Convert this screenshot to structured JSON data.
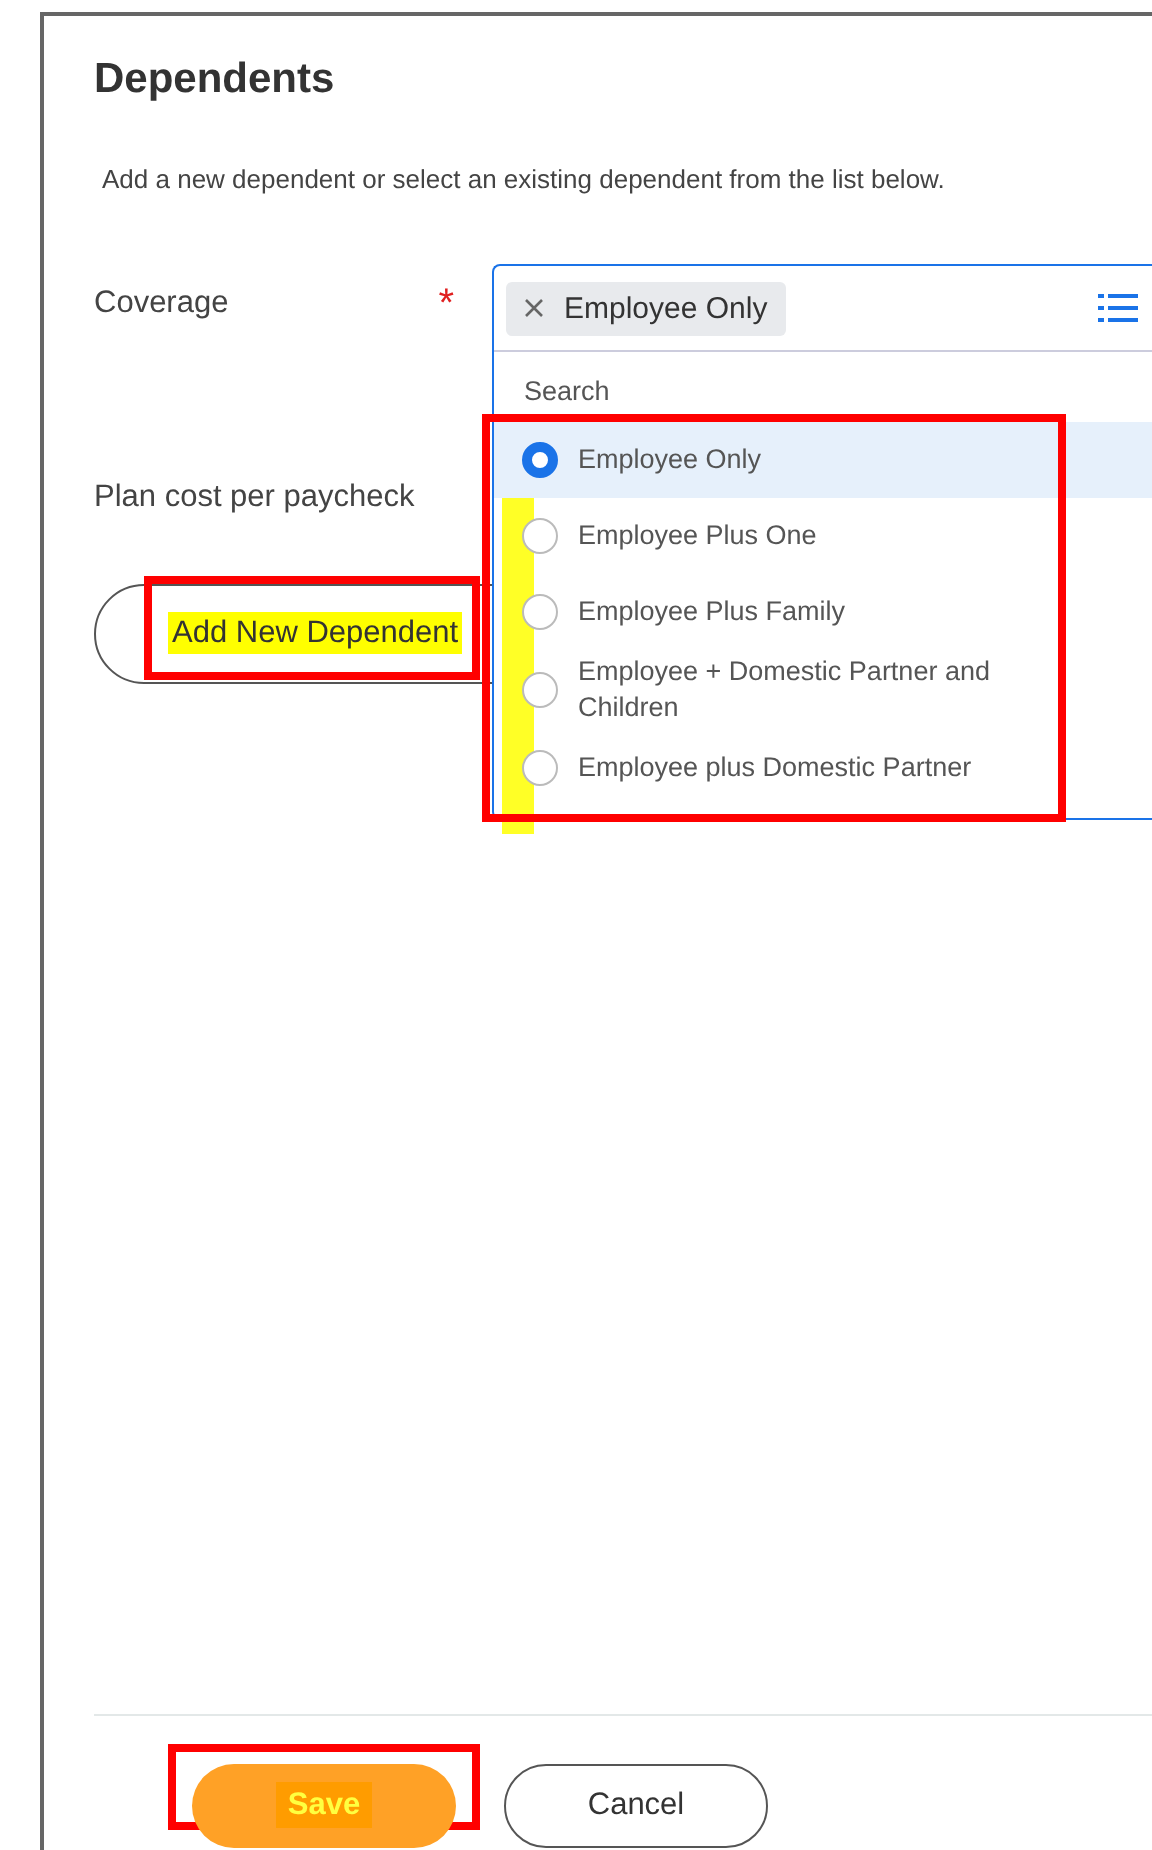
{
  "title": "Dependents",
  "description": "Add a new dependent or select an existing dependent from the list below.",
  "coverage": {
    "label": "Coverage",
    "required": true,
    "required_mark": "*",
    "chip": "Employee Only",
    "dropdown": {
      "search_placeholder": "Search",
      "boxed": true,
      "highlighted": true,
      "options": [
        {
          "label": "Employee Only",
          "selected": true
        },
        {
          "label": "Employee Plus One",
          "selected": false
        },
        {
          "label": "Employee Plus Family",
          "selected": false
        },
        {
          "label": "Employee + Domestic Partner and Children",
          "selected": false
        },
        {
          "label": "Employee plus Domestic Partner",
          "selected": false
        }
      ]
    }
  },
  "plan_cost": {
    "label": "Plan cost per paycheck"
  },
  "add_button": {
    "label": "Add New Dependent",
    "boxed": true,
    "highlighted": true
  },
  "footer": {
    "buttons": [
      {
        "label": "Save",
        "kind": "primary",
        "boxed": true,
        "highlighted": true
      },
      {
        "label": "Cancel",
        "kind": "secondary",
        "boxed": false,
        "highlighted": false
      }
    ]
  }
}
